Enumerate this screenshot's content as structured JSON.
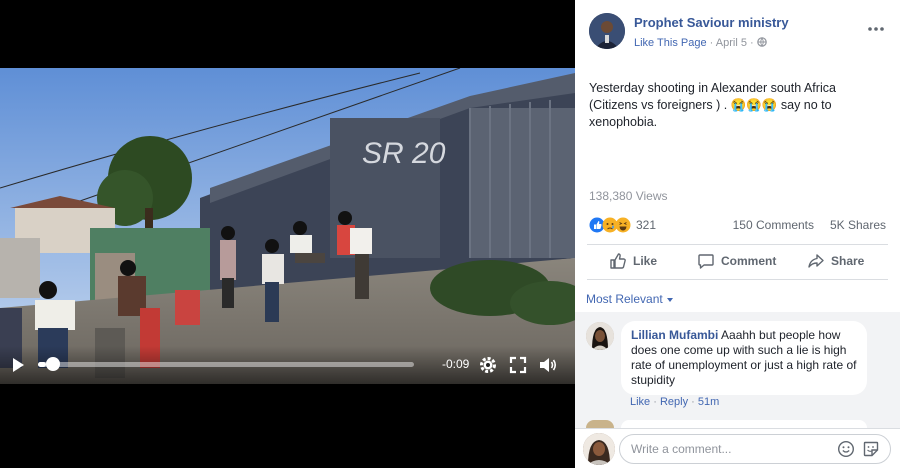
{
  "video": {
    "time_remaining": "-0:09",
    "progress": 0.02,
    "graffiti_text": "SR 20",
    "icons": [
      "play-icon",
      "settings-gear-icon",
      "fullscreen-icon",
      "volume-icon"
    ]
  },
  "post": {
    "page_name": "Prophet Saviour ministry",
    "like_page_label": "Like This Page",
    "separator": "·",
    "date": "April 5",
    "audience_icon": "globe-icon",
    "more_icon": "ellipsis-icon",
    "text": "Yesterday shooting in Alexander south Africa (Citizens vs foreigners ) . 😭😭😭 say no to xenophobia.",
    "views": "138,380 Views",
    "reactions": {
      "icons": [
        "like-reaction-icon",
        "sad-reaction-icon",
        "haha-reaction-icon"
      ],
      "count": "321"
    },
    "comments_count": "150 Comments",
    "shares_count": "5K Shares"
  },
  "actions": {
    "like": "Like",
    "comment": "Comment",
    "share": "Share"
  },
  "comments": {
    "sort_label": "Most Relevant",
    "items": [
      {
        "author": "Lillian Mufambi",
        "text": "Aaahh but people how does one come up with such a lie is high rate of unemployment or just a high rate of stupidity",
        "like_label": "Like",
        "reply_label": "Reply",
        "time": "51m"
      }
    ]
  },
  "composer": {
    "placeholder": "Write a comment...",
    "icons": [
      "emoji-icon",
      "sticker-icon"
    ]
  },
  "colors": {
    "link_blue": "#385898",
    "accent_blue": "#4267b2",
    "meta_gray": "#90949c",
    "panel_bg": "#f2f3f5"
  }
}
